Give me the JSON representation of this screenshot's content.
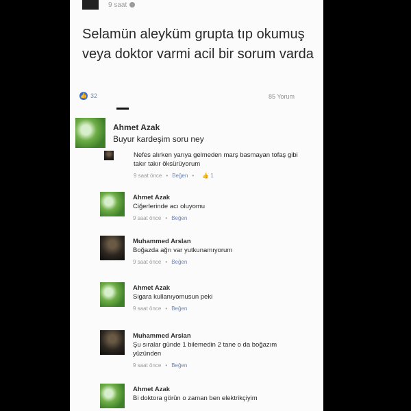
{
  "post": {
    "time": "9 saat",
    "text": "Selamün aleyküm grupta tıp okumuş veya doktor varmi acil bir sorum varda",
    "like_count": "32",
    "comment_count": "85 Yorum"
  },
  "comments": [
    {
      "name": "Ahmet Azak",
      "text": "Buyur kardeşim soru ney"
    },
    {
      "name": "",
      "text": "Nefes alırken yarıya gelmeden marş basmayan tofaş gibi takır takır öksürüyorum",
      "time": "9 saat önce",
      "like": "Beğen",
      "likes": "1"
    },
    {
      "name": "Ahmet Azak",
      "text": "Ciğerlerinde acı oluyomu",
      "time": "9 saat önce",
      "like": "Beğen"
    },
    {
      "name": "Muhammed Arslan",
      "text": "Boğazda ağrı var yutkunamıyorum",
      "time": "9 saat önce",
      "like": "Beğen"
    },
    {
      "name": "Ahmet Azak",
      "text": "Sigara kullanıyomusun peki",
      "time": "9 saat önce",
      "like": "Beğen"
    },
    {
      "name": "Muhammed Arslan",
      "text": "Şu sıralar günde 1 bilemedin 2 tane o da boğazım yüzünden",
      "time": "9 saat önce",
      "like": "Beğen"
    },
    {
      "name": "Ahmet Azak",
      "text": "Bi doktora görün o zaman ben elektrikçiyim"
    }
  ]
}
